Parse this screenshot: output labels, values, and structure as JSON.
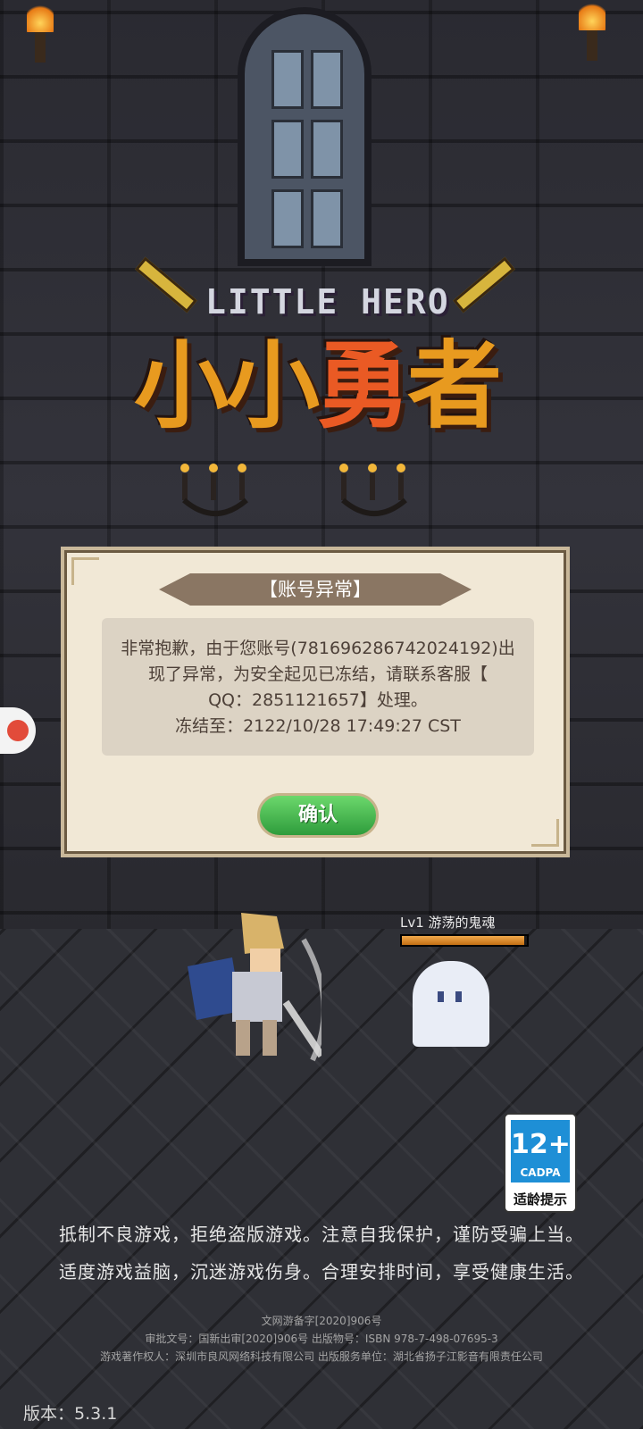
{
  "logo": {
    "en": "LITTLE HERO",
    "zh_1": "小小",
    "zh_2": "勇",
    "zh_3": "者"
  },
  "dialog": {
    "title": "【账号异常】",
    "line1": "非常抱歉，由于您账号(781696286742024192)出",
    "line2": "现了异常，为安全起见已冻结，请联系客服【",
    "line3": "QQ：2851121657】处理。",
    "line4": "冻结至：2122/10/28 17:49:27 CST",
    "ok_label": "确认"
  },
  "enemy": {
    "label": "Lv1 游荡的鬼魂",
    "hp_fraction": 0.98
  },
  "age_rating": {
    "number": "12+",
    "org": "CADPA",
    "tip": "适龄提示"
  },
  "notice": {
    "line1": "抵制不良游戏，拒绝盗版游戏。注意自我保护，谨防受骗上当。",
    "line2": "适度游戏益脑，沉迷游戏伤身。合理安排时间，享受健康生活。"
  },
  "legal": {
    "line1": "文网游备字[2020]906号",
    "line2": "审批文号：国新出审[2020]906号  出版物号：ISBN 978-7-498-07695-3",
    "line3": "游戏著作权人：深圳市良风网络科技有限公司  出版服务单位：湖北省扬子江影音有限责任公司"
  },
  "version": "版本：5.3.1",
  "icons": [
    "torch-icon",
    "side-menu-icon",
    "ghost-sprite",
    "hero-sprite",
    "age-rating-badge"
  ]
}
